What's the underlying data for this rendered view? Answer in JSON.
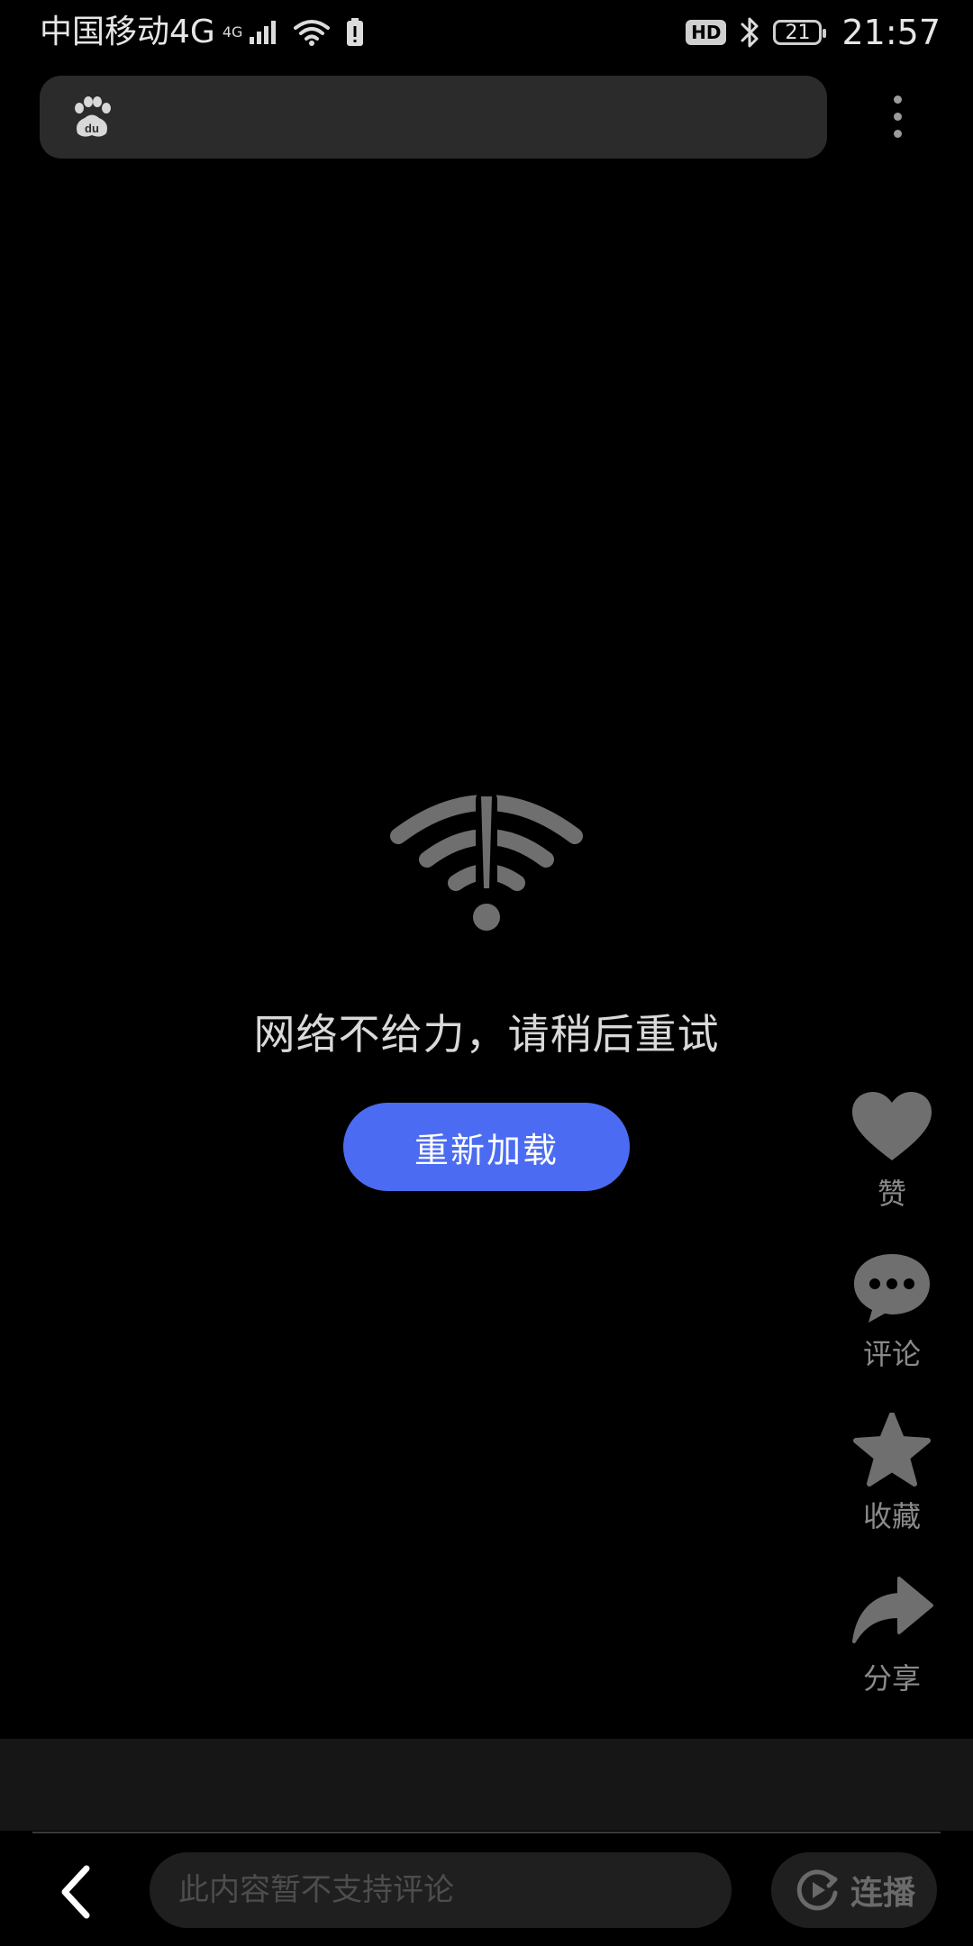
{
  "status_bar": {
    "carrier": "中国移动4G",
    "network_small": "4G",
    "battery_level": "21",
    "time": "21:57",
    "hd_label": "HD"
  },
  "error": {
    "message": "网络不给力，请稍后重试",
    "reload_label": "重新加载"
  },
  "actions": [
    {
      "label": "赞",
      "icon": "heart-icon"
    },
    {
      "label": "评论",
      "icon": "comment-icon"
    },
    {
      "label": "收藏",
      "icon": "star-icon"
    },
    {
      "label": "分享",
      "icon": "share-icon"
    }
  ],
  "bottom": {
    "comment_placeholder": "此内容暂不支持评论",
    "autoplay_label": "连播"
  },
  "colors": {
    "accent": "#4b6cf2",
    "icon_gray": "#6f6f6f",
    "label_gray": "#8a8a8a"
  }
}
